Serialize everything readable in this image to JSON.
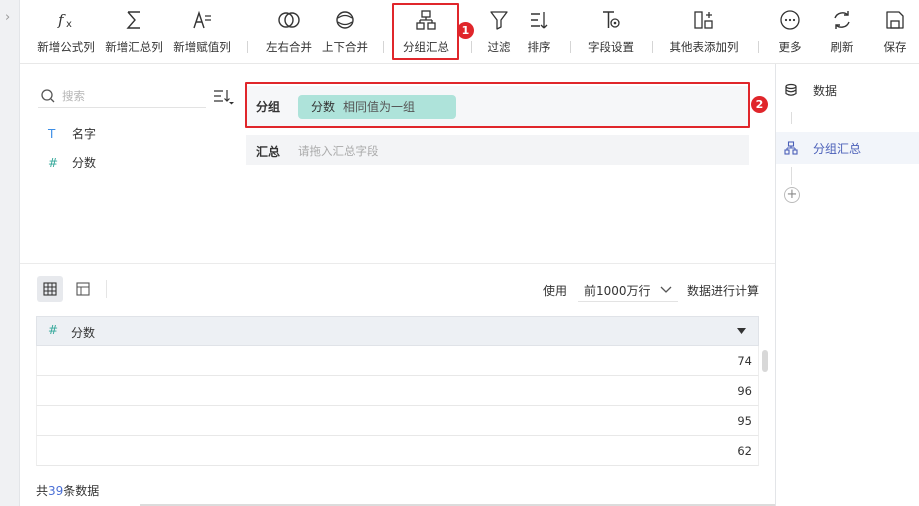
{
  "toolbar": {
    "items": [
      {
        "key": "add_formula_col",
        "label": "新增公式列",
        "icon": "formula-icon"
      },
      {
        "key": "add_summary_col",
        "label": "新增汇总列",
        "icon": "sigma-icon"
      },
      {
        "key": "add_assign_col",
        "label": "新增赋值列",
        "icon": "assign-icon"
      },
      {
        "key": "merge_lr",
        "label": "左右合并",
        "icon": "venn-icon"
      },
      {
        "key": "merge_tb",
        "label": "上下合并",
        "icon": "union-icon"
      },
      {
        "key": "group_summary",
        "label": "分组汇总",
        "icon": "group-tree-icon"
      },
      {
        "key": "filter",
        "label": "过滤",
        "icon": "filter-icon"
      },
      {
        "key": "sort",
        "label": "排序",
        "icon": "sort-icon"
      },
      {
        "key": "field_settings",
        "label": "字段设置",
        "icon": "field-settings-icon"
      },
      {
        "key": "add_from_other_table",
        "label": "其他表添加列",
        "icon": "add-column-icon"
      },
      {
        "key": "more",
        "label": "更多",
        "icon": "more-icon"
      },
      {
        "key": "refresh",
        "label": "刷新",
        "icon": "refresh-icon"
      },
      {
        "key": "save",
        "label": "保存",
        "icon": "save-icon"
      }
    ]
  },
  "annotations": {
    "marker1": "1",
    "marker2": "2",
    "color": "#e0262b"
  },
  "fields_panel": {
    "search_placeholder": "搜索",
    "fields": [
      {
        "type_icon": "T",
        "name": "名字",
        "kind": "text"
      },
      {
        "type_icon": "#",
        "name": "分数",
        "kind": "number"
      }
    ]
  },
  "config": {
    "group_label": "分组",
    "group_field": "分数",
    "group_method": "相同值为一组",
    "summary_label": "汇总",
    "summary_placeholder": "请拖入汇总字段"
  },
  "steps": {
    "items": [
      {
        "label": "数据",
        "icon": "database-icon",
        "active": false
      },
      {
        "label": "分组汇总",
        "icon": "group-tree-icon",
        "active": true
      }
    ],
    "add_label": "+"
  },
  "preview": {
    "use_label": "使用",
    "rows_option": "前1000万行",
    "calc_label": "数据进行计算",
    "column": {
      "type_icon": "#",
      "name": "分数",
      "sort_indicator": "▼"
    },
    "rows": [
      "74",
      "96",
      "95",
      "62"
    ],
    "total_prefix": "共",
    "total_count": "39",
    "total_suffix": "条数据"
  },
  "colors": {
    "chip_bg": "#aee3da",
    "accent_blue": "#4a5fb8",
    "number_green": "#34a89a",
    "text_blue": "#3d8ee6"
  }
}
